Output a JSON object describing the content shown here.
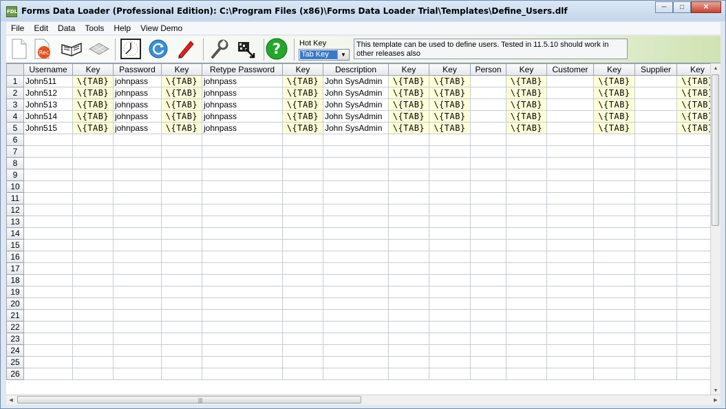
{
  "window": {
    "app_icon_text": "FDL",
    "title": "Forms Data Loader (Professional Edition): C:\\Program Files (x86)\\Forms Data Loader Trial\\Templates\\Define_Users.dlf"
  },
  "menu": [
    "File",
    "Edit",
    "Data",
    "Tools",
    "Help",
    "View Demo"
  ],
  "toolbar": {
    "hotkey_label": "Hot Key",
    "hotkey_value": "Tab Key",
    "description": "This template can be used to define users. Tested in 11.5.10 should work in other releases also"
  },
  "grid": {
    "columns": [
      "Username",
      "Key",
      "Password",
      "Key",
      "Retype Password",
      "Key",
      "Description",
      "Key",
      "Key",
      "Person",
      "Key",
      "Customer",
      "Key",
      "Supplier",
      "Key"
    ],
    "key_text": "\\{TAB}",
    "rows": [
      [
        "John511",
        "\\{TAB}",
        "johnpass",
        "\\{TAB}",
        "johnpass",
        "\\{TAB}",
        "John SysAdmin",
        "\\{TAB}",
        "\\{TAB}",
        "",
        "\\{TAB}",
        "",
        "\\{TAB}",
        "",
        "\\{TAB}"
      ],
      [
        "John512",
        "\\{TAB}",
        "johnpass",
        "\\{TAB}",
        "johnpass",
        "\\{TAB}",
        "John SysAdmin",
        "\\{TAB}",
        "\\{TAB}",
        "",
        "\\{TAB}",
        "",
        "\\{TAB}",
        "",
        "\\{TAB}"
      ],
      [
        "John513",
        "\\{TAB}",
        "johnpass",
        "\\{TAB}",
        "johnpass",
        "\\{TAB}",
        "John SysAdmin",
        "\\{TAB}",
        "\\{TAB}",
        "",
        "\\{TAB}",
        "",
        "\\{TAB}",
        "",
        "\\{TAB}"
      ],
      [
        "John514",
        "\\{TAB}",
        "johnpass",
        "\\{TAB}",
        "johnpass",
        "\\{TAB}",
        "John SysAdmin",
        "\\{TAB}",
        "\\{TAB}",
        "",
        "\\{TAB}",
        "",
        "\\{TAB}",
        "",
        "\\{TAB}"
      ],
      [
        "John515",
        "\\{TAB}",
        "johnpass",
        "\\{TAB}",
        "johnpass",
        "\\{TAB}",
        "John SysAdmin",
        "\\{TAB}",
        "\\{TAB}",
        "",
        "\\{TAB}",
        "",
        "\\{TAB}",
        "",
        "\\{TAB}"
      ]
    ],
    "row_numbers": [
      "1",
      "2",
      "3",
      "4",
      "5",
      "6",
      "7",
      "8",
      "9",
      "10",
      "11",
      "12",
      "13",
      "14",
      "15",
      "16",
      "17",
      "18",
      "19",
      "20",
      "21",
      "22",
      "23",
      "24",
      "25",
      "26"
    ]
  },
  "colors": {
    "key_cell": "#fefed8",
    "hotkey_selected": "#3b78c8",
    "close_button": "#c7432f"
  }
}
